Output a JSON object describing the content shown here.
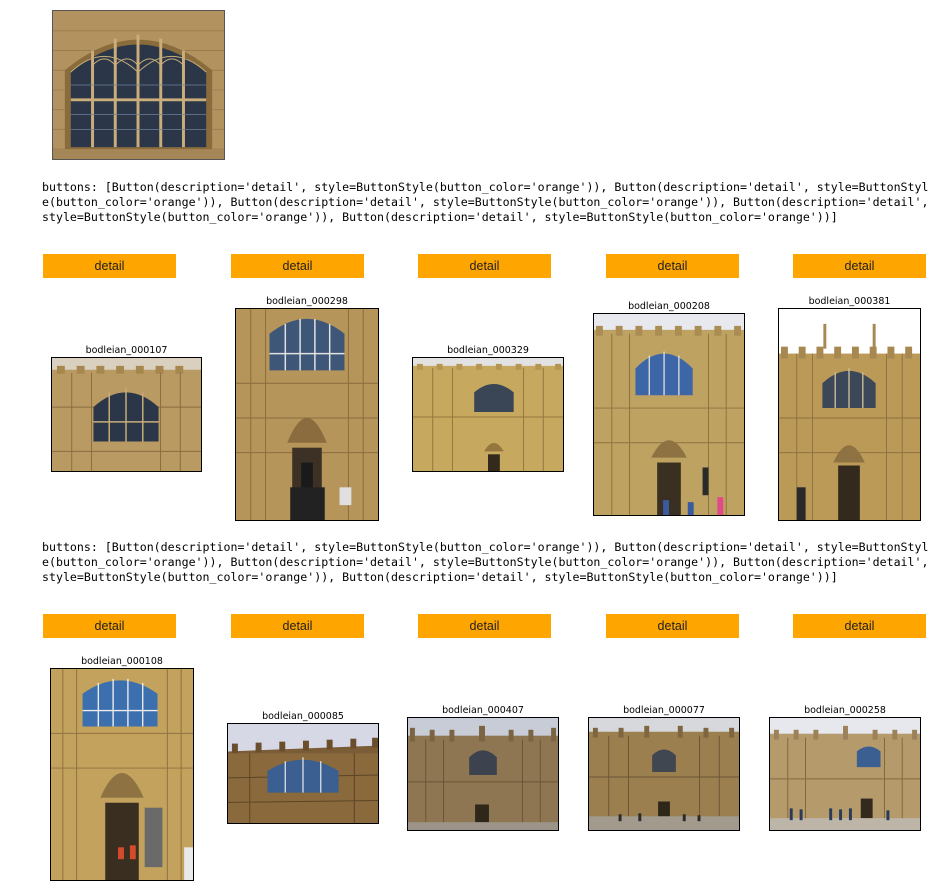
{
  "output_1": {
    "text": "buttons: [Button(description='detail', style=ButtonStyle(button_color='orange')), Button(description='detail', style=ButtonStyle(button_color='orange')), Button(description='detail', style=ButtonStyle(button_color='orange')), Button(description='detail', style=ButtonStyle(button_color='orange')), Button(description='detail', style=ButtonStyle(button_color='orange'))]",
    "buttons": [
      "detail",
      "detail",
      "detail",
      "detail",
      "detail"
    ],
    "button_color": "#ffa500",
    "images": [
      "bodleian_000107",
      "bodleian_000298",
      "bodleian_000329",
      "bodleian_000208",
      "bodleian_000381"
    ]
  },
  "output_2": {
    "text": "buttons: [Button(description='detail', style=ButtonStyle(button_color='orange')), Button(description='detail', style=ButtonStyle(button_color='orange')), Button(description='detail', style=ButtonStyle(button_color='orange')), Button(description='detail', style=ButtonStyle(button_color='orange')), Button(description='detail', style=ButtonStyle(button_color='orange'))]",
    "buttons": [
      "detail",
      "detail",
      "detail",
      "detail",
      "detail"
    ],
    "button_color": "#ffa500",
    "images": [
      "bodleian_000108",
      "bodleian_000085",
      "bodleian_000407",
      "bodleian_000077",
      "bodleian_000258"
    ]
  }
}
